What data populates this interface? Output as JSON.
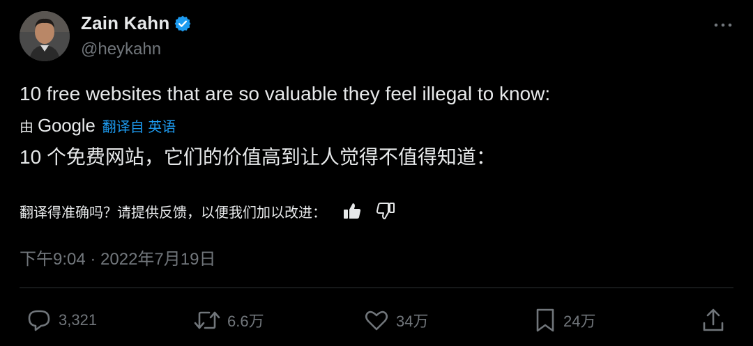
{
  "author": {
    "name": "Zain Kahn",
    "handle": "@heykahn"
  },
  "tweet": {
    "text": "10 free websites that are so valuable they feel illegal to know:",
    "translated_by_prefix": "由",
    "translated_by_brand": "Google",
    "translated_from_label": "翻译自 英语",
    "translation": "10 个免费网站，它们的价值高到让人觉得不值得知道：",
    "feedback_prompt": "翻译得准确吗？请提供反馈，以便我们加以改进：",
    "timestamp": "下午9:04 · 2022年7月19日"
  },
  "actions": {
    "reply_count": "3,321",
    "retweet_count": "6.6万",
    "like_count": "34万",
    "bookmark_count": "24万"
  },
  "icons": {
    "verified": "verified-badge-icon",
    "more": "more-horizontal-icon",
    "thumbs_up": "thumbs-up-icon",
    "thumbs_down": "thumbs-down-icon",
    "reply": "reply-icon",
    "retweet": "retweet-icon",
    "like": "heart-icon",
    "bookmark": "bookmark-icon",
    "share": "share-icon"
  },
  "colors": {
    "background": "#000000",
    "text": "#e7e9ea",
    "muted": "#71767b",
    "accent": "#1d9bf0",
    "divider": "#2f3336"
  }
}
